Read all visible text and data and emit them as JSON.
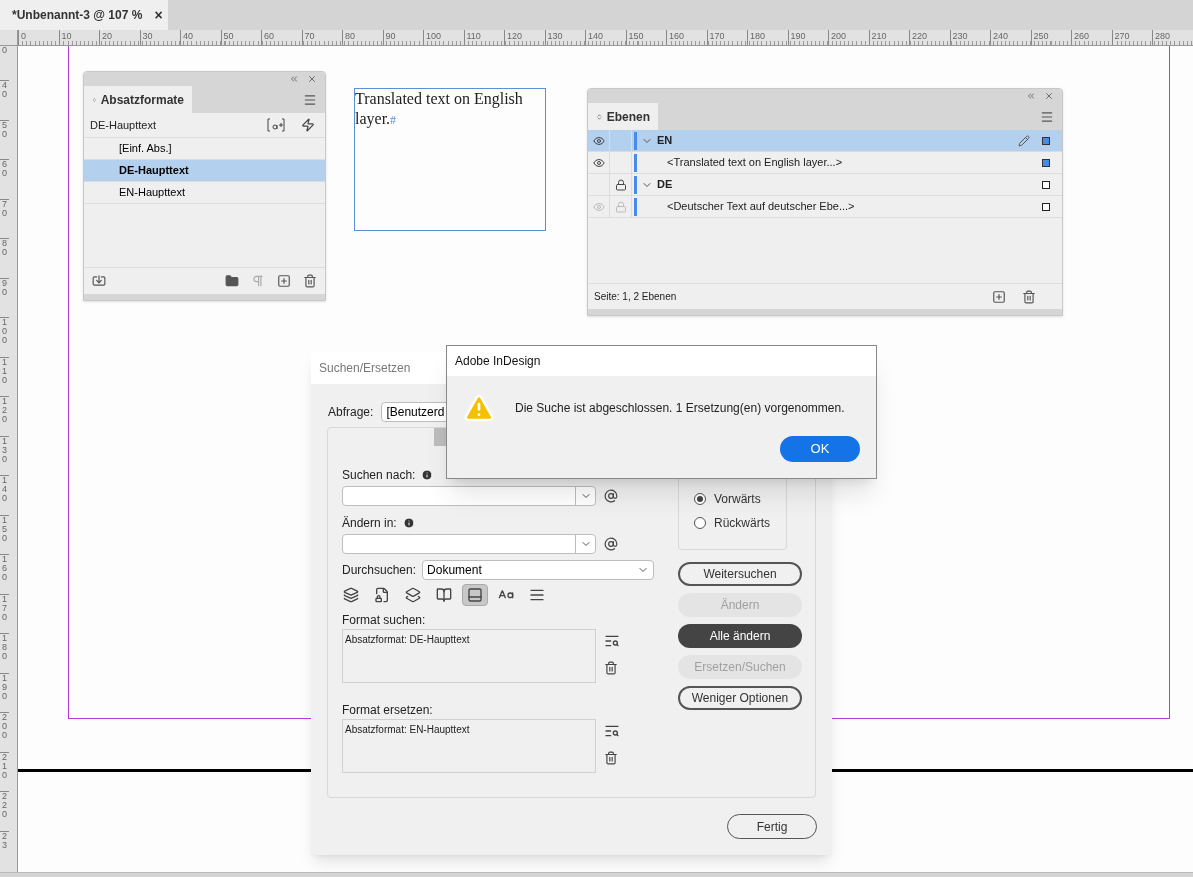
{
  "document_tab": {
    "title": "*Unbenannt-3 @ 107 %",
    "close": "×"
  },
  "ruler": {
    "horizontal": [
      "0",
      "10",
      "20",
      "30",
      "40",
      "50",
      "60",
      "70",
      "80",
      "90",
      "100",
      "110",
      "120",
      "130",
      "140",
      "150",
      "160",
      "170",
      "180",
      "190",
      "200",
      "210",
      "220",
      "230",
      "240",
      "250",
      "260",
      "270",
      "280"
    ],
    "vertical": [
      "0",
      "40",
      "50",
      "60",
      "70",
      "80",
      "90",
      "100",
      "110",
      "120",
      "130",
      "140",
      "150",
      "160",
      "170",
      "180",
      "190",
      "200",
      "210",
      "220",
      "23"
    ]
  },
  "text_frame": {
    "text": "Translated text on English layer.",
    "end_mark": "#"
  },
  "paragraph_styles_panel": {
    "title": "Absatzformate",
    "current_style": "DE-Haupttext",
    "items": [
      {
        "label": "[Einf. Abs.]",
        "selected": false
      },
      {
        "label": "DE-Haupttext",
        "selected": true
      },
      {
        "label": "EN-Haupttext",
        "selected": false
      }
    ]
  },
  "layers_panel": {
    "title": "Ebenen",
    "rows": [
      {
        "kind": "layer",
        "label": "EN",
        "visible": true,
        "locked": false,
        "inherited": false,
        "selected": true,
        "expanded": true,
        "editing": true,
        "has_selection": true
      },
      {
        "kind": "object",
        "label": "<Translated text on English layer...>",
        "visible": true,
        "locked": false,
        "inherited": false,
        "selected": false,
        "has_selection": true
      },
      {
        "kind": "layer",
        "label": "DE",
        "visible": false,
        "locked": true,
        "inherited": false,
        "selected": false,
        "expanded": true,
        "editing": false,
        "has_selection": false
      },
      {
        "kind": "object",
        "label": "<Deutscher Text auf deutscher Ebe...>",
        "visible": false,
        "locked": true,
        "inherited": true,
        "selected": false,
        "has_selection": false
      }
    ],
    "status": "Seite: 1, 2 Ebenen"
  },
  "find_change_dialog": {
    "title": "Suchen/Ersetzen",
    "query_label": "Abfrage:",
    "query_value": "[Benutzerd",
    "find_label": "Suchen nach:",
    "change_label": "Ändern in:",
    "search_label": "Durchsuchen:",
    "search_value": "Dokument",
    "options": [
      {
        "selected": false
      },
      {
        "selected": false
      },
      {
        "selected": false
      },
      {
        "selected": false
      },
      {
        "selected": true
      },
      {
        "selected": false
      },
      {
        "selected": false
      }
    ],
    "format_find_label": "Format suchen:",
    "format_find_value": "Absatzformat: DE-Haupttext",
    "format_change_label": "Format ersetzen:",
    "format_change_value": "Absatzformat: EN-Haupttext",
    "directions": [
      {
        "label": "Vorwärts",
        "selected": true
      },
      {
        "label": "Rückwärts",
        "selected": false
      }
    ],
    "buttons": [
      {
        "label": "Weitersuchen",
        "kind": "outline"
      },
      {
        "label": "Ändern",
        "kind": "disabled"
      },
      {
        "label": "Alle ändern",
        "kind": "primary"
      },
      {
        "label": "Ersetzen/Suchen",
        "kind": "disabled"
      },
      {
        "label": "Weniger Optionen",
        "kind": "outline"
      }
    ],
    "done_button": "Fertig"
  },
  "alert": {
    "title": "Adobe InDesign",
    "message": "Die Suche ist abgeschlossen. 1 Ersetzung(en) vorgenommen.",
    "button": "OK"
  }
}
